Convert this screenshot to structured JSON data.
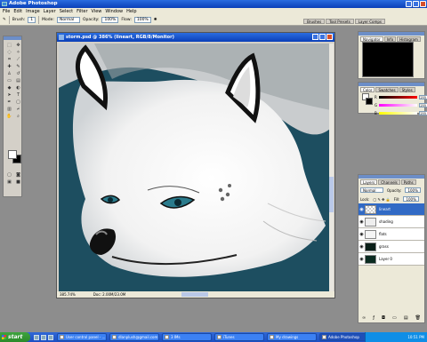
{
  "app": {
    "title": "Adobe Photoshop"
  },
  "menu": [
    "File",
    "Edit",
    "Image",
    "Layer",
    "Select",
    "Filter",
    "View",
    "Window",
    "Help"
  ],
  "options": {
    "brush_label": "Brush:",
    "brush_size": "1",
    "mode_label": "Mode:",
    "mode_value": "Normal",
    "opacity_label": "Opacity:",
    "opacity_value": "100%",
    "flow_label": "Flow:",
    "flow_value": "100%"
  },
  "palette_well": [
    "Brushes",
    "Tool Presets",
    "Layer Comps"
  ],
  "document": {
    "title": "storm.psd @ 386% (lineart, RGB/8/Monitor)",
    "zoom": "385.74%",
    "doc_size": "Doc: 2.00M/23.0M"
  },
  "navigator": {
    "tabs": [
      "Navigator",
      "Info",
      "Histogram"
    ],
    "zoom": "385.74%"
  },
  "color_panel": {
    "tabs": [
      "Color",
      "Swatches",
      "Styles"
    ],
    "channels": [
      {
        "label": "R",
        "value": "255"
      },
      {
        "label": "G",
        "value": "255"
      },
      {
        "label": "B",
        "value": "255"
      }
    ],
    "colors": {
      "r_bar": "#ff0000",
      "g_bar": "#ff00ff",
      "b_bar": "#ffff00"
    }
  },
  "layers_panel": {
    "tabs": [
      "Layers",
      "Channels",
      "Paths"
    ],
    "blend_mode": "Normal",
    "opacity_label": "Opacity:",
    "opacity_value": "100%",
    "lock_label": "Lock:",
    "fill_label": "Fill:",
    "fill_value": "100%",
    "layers": [
      {
        "name": "lineart",
        "selected": true
      },
      {
        "name": "shading",
        "selected": false
      },
      {
        "name": "flats",
        "selected": false
      },
      {
        "name": "grass",
        "selected": false
      },
      {
        "name": "Layer 0",
        "selected": false
      }
    ]
  },
  "taskbar": {
    "start": "start",
    "buttons": [
      {
        "label": "User control panel - ..."
      },
      {
        "label": "dlanplush@gmail.com"
      },
      {
        "label": "3 IMs"
      },
      {
        "label": "iTunes"
      },
      {
        "label": "My drawings"
      },
      {
        "label": "Adobe Photoshop",
        "active": true
      }
    ],
    "time": "10:51 PM"
  }
}
